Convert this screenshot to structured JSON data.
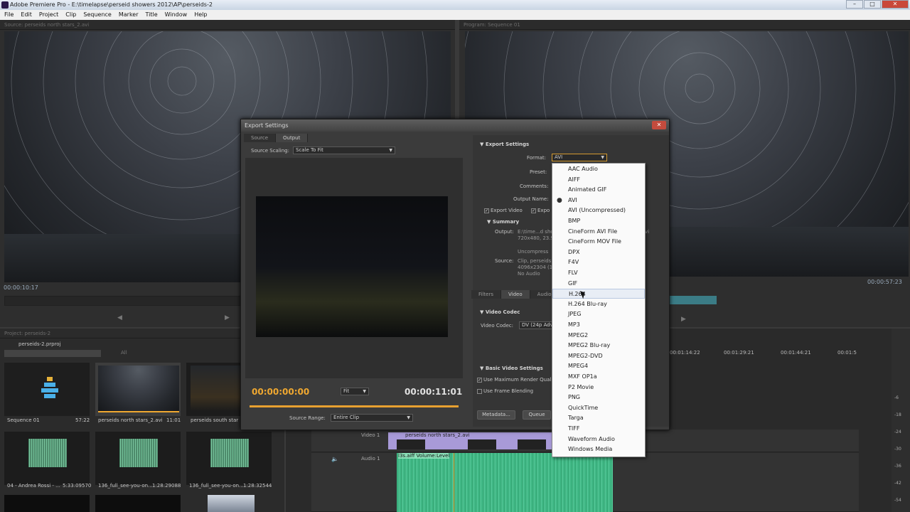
{
  "window": {
    "title": "Adobe Premiere Pro - E:\\timelapse\\perseid showers 2012\\AP\\perseids-2",
    "min": "–",
    "max": "□",
    "close": "✕"
  },
  "menu": [
    "File",
    "Edit",
    "Project",
    "Clip",
    "Sequence",
    "Marker",
    "Title",
    "Window",
    "Help"
  ],
  "source_monitor": {
    "tab": "Source: perseids north stars_2.avi",
    "timecode": "00:00:10:17"
  },
  "program_monitor": {
    "tab": "Program: Sequence 01",
    "timecode": "00:00:57:23"
  },
  "project": {
    "tab": "Project: perseids-2",
    "file": "perseids-2.prproj",
    "filter": "All",
    "items": [
      {
        "name": "Sequence 01",
        "duration": "57:22"
      },
      {
        "name": "perseids north stars_2.avi",
        "duration": "11:01"
      },
      {
        "name": "perseids south star",
        "duration": ""
      },
      {
        "name": "04 - Andrea Rossi - ...",
        "duration": "5:33:09570"
      },
      {
        "name": "136_full_see-you-on...",
        "duration": "1:28:29088"
      },
      {
        "name": "136_full_see-you-on...",
        "duration": "1:28:32544"
      }
    ]
  },
  "timeline": {
    "ticks": [
      "00:01:14:22",
      "00:01:29:21",
      "00:01:44:21",
      "00:01:5"
    ],
    "video_track": "Video 1",
    "video_clip": "perseids north stars_2.avi",
    "audio_track": "Audio 1",
    "audio_clip": "l3s.aiff  Volume:Level",
    "meter": [
      "-6",
      "-12",
      "-18",
      "-24",
      "-30",
      "-36",
      "-42",
      "-48",
      "-54"
    ]
  },
  "export": {
    "title": "Export Settings",
    "close": "✕",
    "tabs": [
      "Source",
      "Output"
    ],
    "source_scaling_label": "Source Scaling:",
    "source_scaling_value": "Scale To Fit",
    "timecode_in": "00:00:00:00",
    "fit": "Fit",
    "timecode_out": "00:00:11:01",
    "source_range_label": "Source Range:",
    "source_range_value": "Entire Clip",
    "settings_header": "Export Settings",
    "format_label": "Format:",
    "format_value": "AVI",
    "preset_label": "Preset:",
    "comments_label": "Comments:",
    "output_name_label": "Output Name:",
    "export_video": "Export Video",
    "export_audio": "Expo",
    "summary_header": "Summary",
    "output_label": "Output:",
    "output_value_1": "E:\\time...d sho",
    "output_value_2": "720x480, 23.97",
    "output_value_tail": "vi",
    "uncompressed": "Uncompress",
    "source_label": "Source:",
    "source_value_1": "Clip, perseids",
    "source_value_2": "4096x2304 (1.",
    "source_value_3": "No Audio",
    "lower_tabs": [
      "Filters",
      "Video",
      "Audio"
    ],
    "video_codec_header": "Video Codec",
    "video_codec_label": "Video Codec:",
    "video_codec_value": "DV (24p Adv",
    "basic_header": "Basic Video Settings",
    "max_render": "Use Maximum Render Qualit",
    "frame_blending": "Use Frame Blending",
    "metadata_btn": "Metadata...",
    "queue_btn": "Queue"
  },
  "format_dropdown": {
    "selected": "AVI",
    "hovered": "H.264",
    "options": [
      "AAC Audio",
      "AIFF",
      "Animated GIF",
      "AVI",
      "AVI (Uncompressed)",
      "BMP",
      "CineForm AVI File",
      "CineForm MOV File",
      "DPX",
      "F4V",
      "FLV",
      "GIF",
      "H.264",
      "H.264 Blu-ray",
      "JPEG",
      "MP3",
      "MPEG2",
      "MPEG2 Blu-ray",
      "MPEG2-DVD",
      "MPEG4",
      "MXF OP1a",
      "P2 Movie",
      "PNG",
      "QuickTime",
      "Targa",
      "TIFF",
      "Waveform Audio",
      "Windows Media"
    ]
  },
  "colors": {
    "timecode_orange": "#f0a830",
    "audio_green": "#46c48e",
    "video_purple": "#a89ad8"
  }
}
